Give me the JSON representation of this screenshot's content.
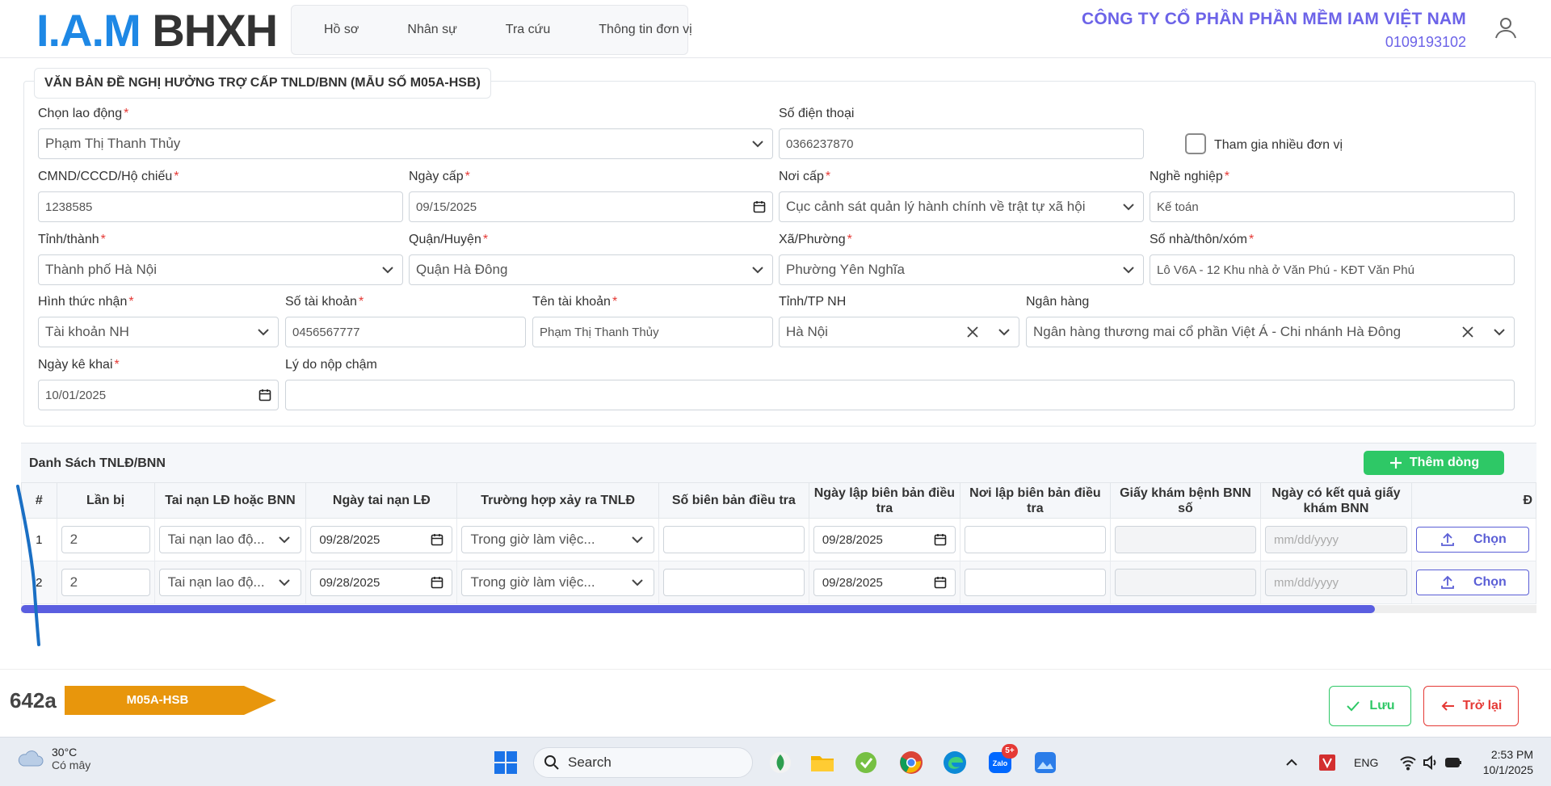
{
  "header": {
    "logo_part1": "I.A.M",
    "logo_part2": "BHXH",
    "nav": [
      "Hồ sơ",
      "Nhân sự",
      "Tra cứu",
      "Thông tin đơn vị"
    ],
    "company_name": "CÔNG TY CỔ PHẦN PHẦN MỀM IAM VIỆT NAM",
    "company_code": "0109193102"
  },
  "form": {
    "title": "VĂN BẢN ĐỀ NGHỊ HƯỞNG TRỢ CẤP TNLD/BNN (MẪU SỐ M05A-HSB)",
    "required_mark": "*",
    "labels": {
      "employee": "Chọn lao động",
      "phone": "Số điện thoại",
      "multi_unit": "Tham gia nhiều đơn vị",
      "id_no": "CMND/CCCD/Hộ chiếu",
      "issue_date": "Ngày cấp",
      "issue_place": "Nơi cấp",
      "occupation": "Nghề nghiệp",
      "province": "Tỉnh/thành",
      "district": "Quận/Huyện",
      "ward": "Xã/Phường",
      "address": "Số nhà/thôn/xóm",
      "receive_method": "Hình thức nhận",
      "account_no": "Số tài khoản",
      "account_name": "Tên tài khoản",
      "bank_province": "Tỉnh/TP NH",
      "bank": "Ngân hàng",
      "declare_date": "Ngày kê khai",
      "late_reason": "Lý do nộp chậm"
    },
    "values": {
      "employee": "Phạm Thị Thanh Thủy",
      "phone": "0366237870",
      "id_no": "1238585",
      "issue_date": "09/15/2025",
      "issue_place": "Cục cảnh sát quản lý hành chính về trật tự xã hội",
      "occupation": "Kế toán",
      "province": "Thành phố Hà Nội",
      "district": "Quận Hà Đông",
      "ward": "Phường Yên Nghĩa",
      "address": "Lô V6A - 12 Khu nhà ở Văn Phú - KĐT Văn Phú",
      "receive_method": "Tài khoản NH",
      "account_no": "0456567777",
      "account_name": "Phạm Thị Thanh Thủy",
      "bank_province": "Hà Nội",
      "bank": "Ngân hàng thương mai cổ phần Việt Á - Chi nhánh Hà Đông",
      "declare_date": "10/01/2025",
      "late_reason": ""
    }
  },
  "table": {
    "title": "Danh Sách TNLĐ/BNN",
    "add_label": "Thêm dòng",
    "columns": [
      "#",
      "Lần bị",
      "Tai nạn LĐ hoặc BNN",
      "Ngày tai nạn LĐ",
      "Trường hợp xảy ra TNLĐ",
      "Số biên bản điều tra",
      "Ngày lập biên bản điều tra",
      "Nơi lập biên bản điều tra",
      "Giấy khám bệnh BNN số",
      "Ngày có kết quả giấy khám BNN",
      "Đ"
    ],
    "choose_label": "Chọn",
    "date_placeholder": "mm/dd/yyyy",
    "rows": [
      {
        "no": "1",
        "times": "2",
        "type": "Tai nạn lao độ...",
        "date": "09/28/2025",
        "case": "Trong giờ làm việc...",
        "report_no": "",
        "report_date": "09/28/2025",
        "report_place": "",
        "cert_no": ""
      },
      {
        "no": "2",
        "times": "2",
        "type": "Tai nạn lao độ...",
        "date": "09/28/2025",
        "case": "Trong giờ làm việc...",
        "report_no": "",
        "report_date": "09/28/2025",
        "report_place": "",
        "cert_no": ""
      }
    ]
  },
  "footer": {
    "code": "642a",
    "form_tag": "M05A-HSB",
    "save_label": "Lưu",
    "back_label": "Trở lại"
  },
  "taskbar": {
    "temp": "30°C",
    "weather": "Có mây",
    "search": "Search",
    "notif_count": "5+",
    "lang": "ENG",
    "time": "2:53 PM",
    "date": "10/1/2025"
  },
  "colors": {
    "accent": "#6c63e8",
    "green": "#2ec866",
    "red": "#e53935",
    "tag_orange": "#e8960c",
    "logo_blue": "#1e88e5"
  }
}
